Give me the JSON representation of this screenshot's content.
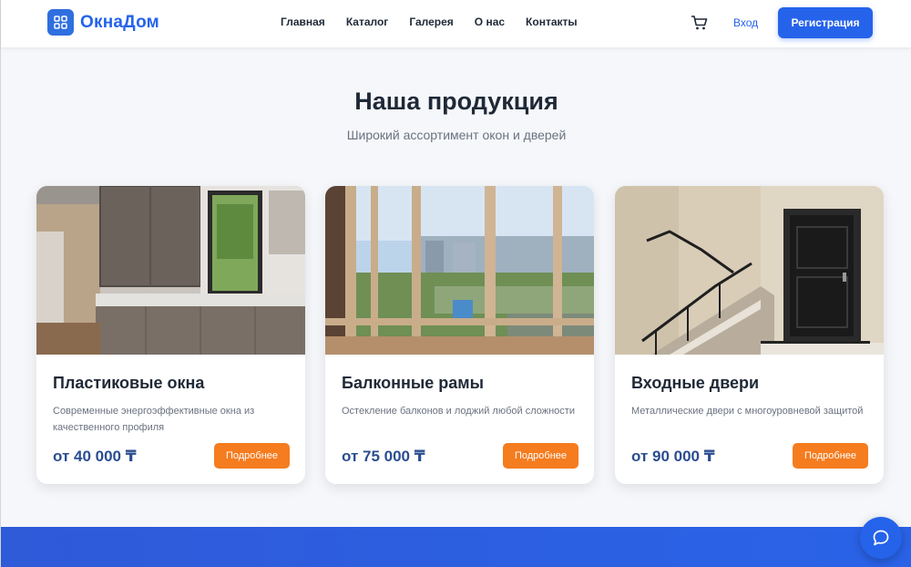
{
  "brand": {
    "name": "ОкнаДом",
    "icon": "grid-icon",
    "accent": "#2563eb"
  },
  "nav": {
    "items": [
      "Главная",
      "Каталог",
      "Галерея",
      "О нас",
      "Контакты"
    ]
  },
  "header_actions": {
    "cart_icon": "cart-icon",
    "login_label": "Вход",
    "register_label": "Регистрация"
  },
  "section": {
    "title": "Наша продукция",
    "subtitle": "Широкий ассортимент окон и дверей"
  },
  "products": [
    {
      "title": "Пластиковые окна",
      "description": "Современные энергоэффективные окна из качественного профиля",
      "price": "от 40 000 ₸",
      "button": "Подробнее",
      "image": "kitchen-window-photo"
    },
    {
      "title": "Балконные рамы",
      "description": "Остекление балконов и лоджий любой сложности",
      "price": "от 75 000 ₸",
      "button": "Подробнее",
      "image": "balcony-glazing-photo"
    },
    {
      "title": "Входные двери",
      "description": "Металлические двери с многоуровневой защитой",
      "price": "от 90 000 ₸",
      "button": "Подробнее",
      "image": "entrance-door-photo"
    }
  ],
  "colors": {
    "primary": "#2563eb",
    "orange_button": "#f57c1f",
    "price": "#2b4d8f"
  },
  "chat": {
    "icon": "chat-bubble-icon"
  }
}
